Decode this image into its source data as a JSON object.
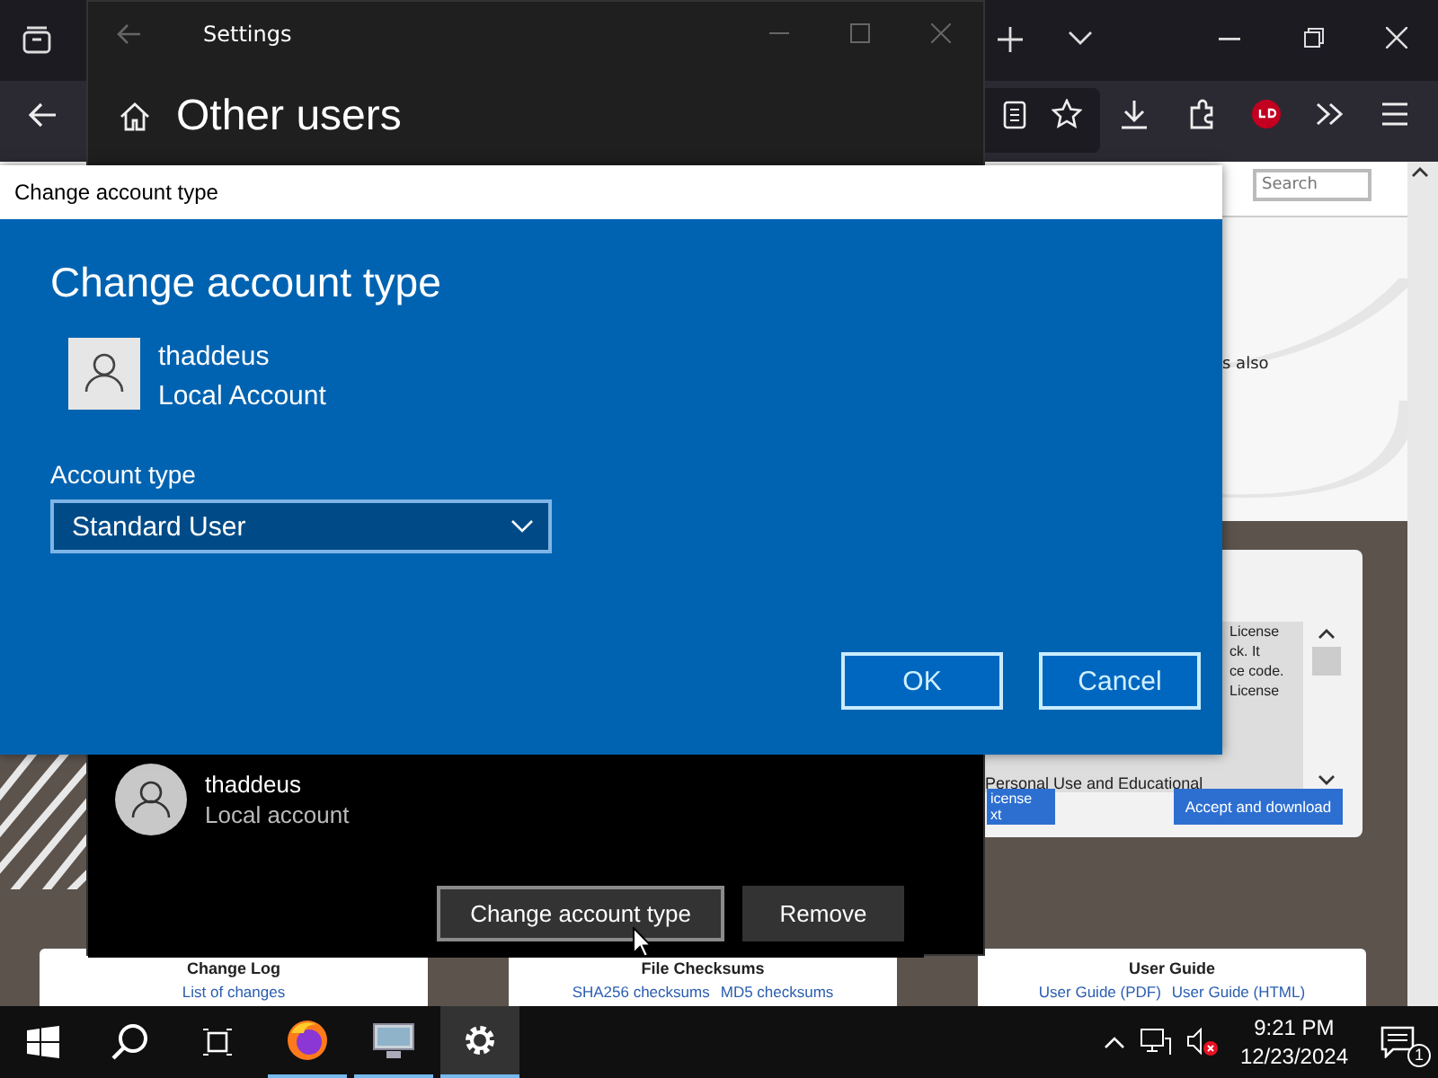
{
  "browser": {
    "search": {
      "placeholder": "Search"
    },
    "fragment": "s also",
    "license_lines": [
      "License",
      "ck. It",
      "ce code.",
      "License"
    ],
    "notice": "Personal Use and Educational",
    "license_button": [
      "icense",
      "xt"
    ],
    "accept_button": "Accept and download",
    "cards": [
      {
        "title": "Change Log",
        "links": [
          "List of changes"
        ]
      },
      {
        "title": "File Checksums",
        "links": [
          "SHA256 checksums",
          "MD5 checksums"
        ]
      },
      {
        "title": "User Guide",
        "links": [
          "User Guide (PDF)",
          "User Guide (HTML)"
        ]
      }
    ]
  },
  "settings": {
    "title": "Settings",
    "heading": "Other users",
    "user": {
      "name": "thaddeus",
      "account": "Local account"
    },
    "buttons": [
      "Change account type",
      "Remove"
    ]
  },
  "dialog": {
    "title": "Change account type",
    "heading": "Change account type",
    "user": {
      "name": "thaddeus",
      "account": "Local Account"
    },
    "field_label": "Account type",
    "value": "Standard User",
    "buttons": [
      "OK",
      "Cancel"
    ]
  },
  "taskbar": {
    "apps": [
      {
        "kind": "firefox",
        "running": true,
        "selected": false
      },
      {
        "kind": "monitor",
        "running": true,
        "selected": false
      },
      {
        "kind": "settings",
        "running": true,
        "selected": true
      }
    ],
    "time": "9:21 PM",
    "date": "12/23/2024",
    "notifications": "1"
  }
}
